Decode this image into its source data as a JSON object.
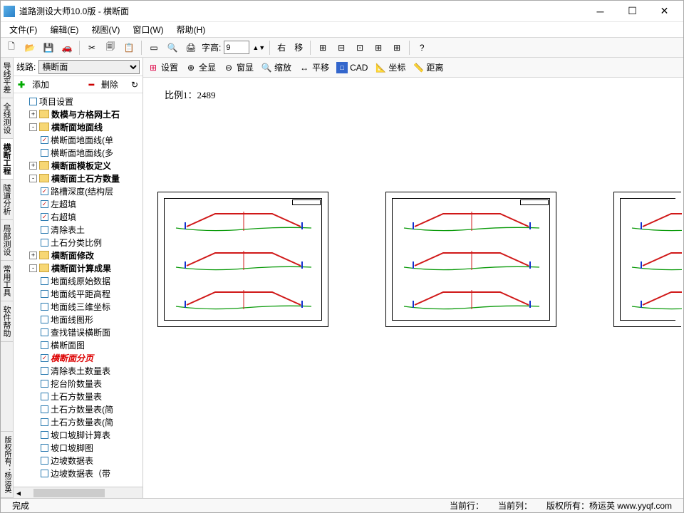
{
  "window": {
    "title": "道路测设大师10.0版 - 横断面"
  },
  "menubar": [
    "文件(F)",
    "编辑(E)",
    "视图(V)",
    "窗口(W)",
    "帮助(H)"
  ],
  "toolbar1": {
    "font_height_label": "字高:",
    "font_height_value": "9",
    "right_label": "右",
    "move_label": "移"
  },
  "left": {
    "line_label": "线路:",
    "line_select": "横断面",
    "add": "添加",
    "del": "删除",
    "vtabs": [
      "导线平差",
      "全线测设",
      "横断工程",
      "隧道分析",
      "局部测设",
      "常用工具",
      "软件帮助"
    ],
    "credit": "版权所有：杨运英"
  },
  "tree": [
    {
      "d": 1,
      "t": "chk",
      "c": false,
      "l": "项目设置"
    },
    {
      "d": 1,
      "t": "fold",
      "e": "+",
      "l": "数模与方格网土石",
      "b": true
    },
    {
      "d": 1,
      "t": "fold",
      "e": "-",
      "l": "横断面地面线",
      "b": true
    },
    {
      "d": 2,
      "t": "chk",
      "c": true,
      "l": "横断面地面线(单"
    },
    {
      "d": 2,
      "t": "chk",
      "c": false,
      "l": "横断面地面线(多"
    },
    {
      "d": 1,
      "t": "fold",
      "e": "+",
      "l": "横断面模板定义",
      "b": true
    },
    {
      "d": 1,
      "t": "fold",
      "e": "-",
      "l": "横断面土石方数量",
      "b": true
    },
    {
      "d": 2,
      "t": "chk",
      "c": true,
      "l": "路槽深度(结构层"
    },
    {
      "d": 2,
      "t": "chk",
      "c": true,
      "l": "左超填"
    },
    {
      "d": 2,
      "t": "chk",
      "c": true,
      "l": "右超填"
    },
    {
      "d": 2,
      "t": "chk",
      "c": false,
      "l": "清除表土"
    },
    {
      "d": 2,
      "t": "chk",
      "c": false,
      "l": "土石分类比例"
    },
    {
      "d": 1,
      "t": "fold",
      "e": "+",
      "l": "横断面修改",
      "b": true
    },
    {
      "d": 1,
      "t": "fold",
      "e": "-",
      "l": "横断面计算成果",
      "b": true
    },
    {
      "d": 2,
      "t": "chk",
      "c": false,
      "l": "地面线原始数据"
    },
    {
      "d": 2,
      "t": "chk",
      "c": false,
      "l": "地面线平距高程"
    },
    {
      "d": 2,
      "t": "chk",
      "c": false,
      "l": "地面线三维坐标"
    },
    {
      "d": 2,
      "t": "chk",
      "c": false,
      "l": "地面线图形"
    },
    {
      "d": 2,
      "t": "chk",
      "c": false,
      "l": "查找错误横断面"
    },
    {
      "d": 2,
      "t": "chk",
      "c": false,
      "l": "横断面图"
    },
    {
      "d": 2,
      "t": "chk",
      "c": true,
      "l": "横断面分页",
      "hl": true
    },
    {
      "d": 2,
      "t": "chk",
      "c": false,
      "l": "清除表土数量表"
    },
    {
      "d": 2,
      "t": "chk",
      "c": false,
      "l": "挖台阶数量表"
    },
    {
      "d": 2,
      "t": "chk",
      "c": false,
      "l": "土石方数量表"
    },
    {
      "d": 2,
      "t": "chk",
      "c": false,
      "l": "土石方数量表(简"
    },
    {
      "d": 2,
      "t": "chk",
      "c": false,
      "l": "土石方数量表(简"
    },
    {
      "d": 2,
      "t": "chk",
      "c": false,
      "l": "坡口坡脚计算表"
    },
    {
      "d": 2,
      "t": "chk",
      "c": false,
      "l": "坡口坡脚图"
    },
    {
      "d": 2,
      "t": "chk",
      "c": false,
      "l": "边坡数据表"
    },
    {
      "d": 2,
      "t": "chk",
      "c": false,
      "l": "边坡数据表（带"
    }
  ],
  "toolbar2": [
    {
      "icon": "grid",
      "label": "设置"
    },
    {
      "icon": "zoom",
      "label": "全显"
    },
    {
      "icon": "zoomwin",
      "label": "窗显"
    },
    {
      "icon": "zoomr",
      "label": "缩放"
    },
    {
      "icon": "pan",
      "label": "平移"
    },
    {
      "icon": "cad",
      "label": "CAD",
      "boxed": true
    },
    {
      "icon": "coord",
      "label": "坐标"
    },
    {
      "icon": "dist",
      "label": "距离"
    }
  ],
  "canvas": {
    "scale_label": "比例1：2489"
  },
  "status": {
    "done": "完成",
    "row": "当前行：",
    "col": "当前列：",
    "copyright": "版权所有：杨运英 www.yyqf.com"
  }
}
